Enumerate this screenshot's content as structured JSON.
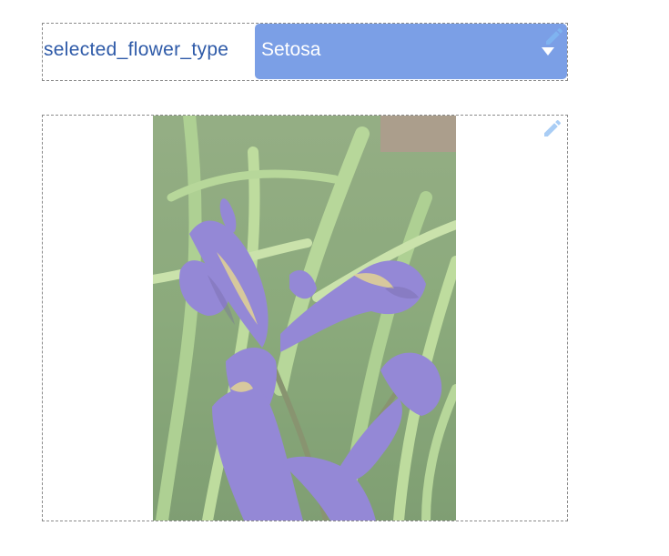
{
  "flower_selector": {
    "label": "selected_flower_type",
    "selected_value": "Setosa",
    "edit_icon": "pencil-icon",
    "dropdown_icon": "caret-down-icon"
  },
  "image_panel": {
    "subject": "iris flower",
    "edit_icon": "pencil-icon"
  },
  "colors": {
    "label_text": "#2e5aa8",
    "select_background": "#7b9fe6",
    "select_text": "#ffffff",
    "frame_border": "#8a8a8a",
    "edit_icon": "#7fb3f0"
  }
}
